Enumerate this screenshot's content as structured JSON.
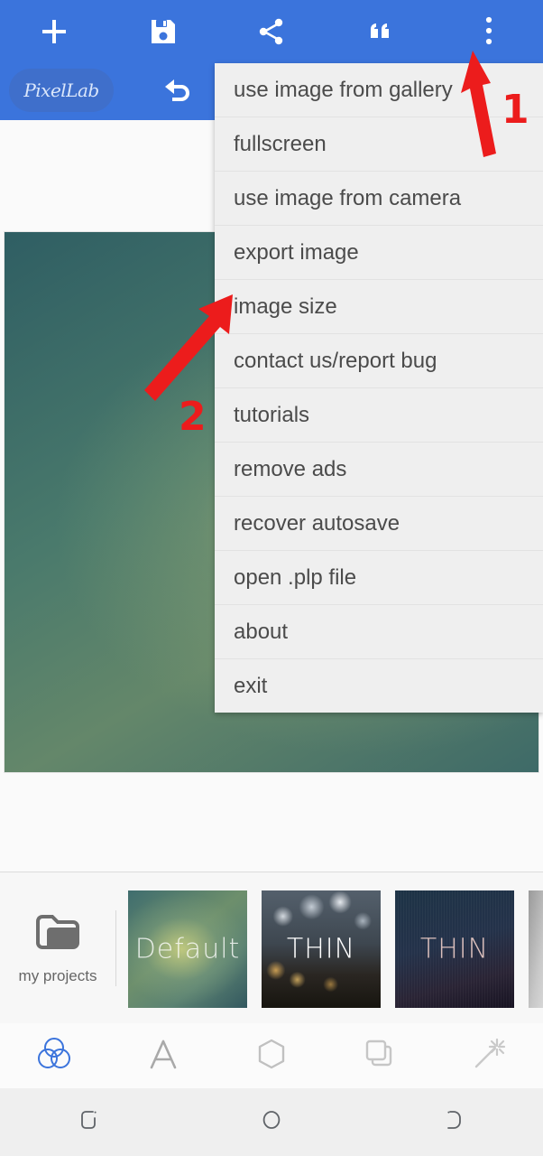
{
  "app": {
    "name": "PixelLab",
    "accent_blue": "#3b74dc",
    "annotation_red": "#ec1c1c"
  },
  "toolbar": {
    "buttons": [
      {
        "name": "add",
        "icon": "plus-icon"
      },
      {
        "name": "save",
        "icon": "save-floppy-icon"
      },
      {
        "name": "share",
        "icon": "share-icon"
      },
      {
        "name": "quote",
        "icon": "quote-icon"
      },
      {
        "name": "overflow",
        "icon": "three-dots-icon"
      }
    ],
    "logo_label": "PixelLab",
    "undo_icon": "undo-arrow-icon"
  },
  "menu": {
    "items": [
      {
        "label": "use image from gallery"
      },
      {
        "label": "fullscreen"
      },
      {
        "label": "use image from camera"
      },
      {
        "label": "export image"
      },
      {
        "label": "image size"
      },
      {
        "label": "contact us/report bug"
      },
      {
        "label": "tutorials"
      },
      {
        "label": "remove ads"
      },
      {
        "label": "recover autosave"
      },
      {
        "label": "open .plp file"
      },
      {
        "label": "about"
      },
      {
        "label": "exit"
      }
    ]
  },
  "projects": {
    "my_projects_label": "my projects",
    "folder_icon": "folder-icon",
    "thumbnails": [
      {
        "label": "Default",
        "style": "thumb-default"
      },
      {
        "label": "THIN",
        "style": "thumb-bokeh"
      },
      {
        "label": "THIN",
        "style": "thumb-thin-dark"
      }
    ]
  },
  "tool_nav": {
    "items": [
      {
        "name": "color-circles",
        "icon": "three-circles-icon",
        "active": true
      },
      {
        "name": "text",
        "icon": "letter-a-icon",
        "active": false
      },
      {
        "name": "shape",
        "icon": "hexagon-icon",
        "active": false
      },
      {
        "name": "layers",
        "icon": "layers-icon",
        "active": false
      },
      {
        "name": "effects",
        "icon": "magic-wand-icon",
        "active": false
      }
    ]
  },
  "system_nav": {
    "items": [
      {
        "name": "recents",
        "icon": "recents-icon"
      },
      {
        "name": "home",
        "icon": "home-circle-icon"
      },
      {
        "name": "back",
        "icon": "back-icon"
      }
    ]
  },
  "annotations": [
    {
      "number": "1",
      "points_to": "overflow-menu-button"
    },
    {
      "number": "2",
      "points_to": "menu-item-image-size"
    }
  ]
}
